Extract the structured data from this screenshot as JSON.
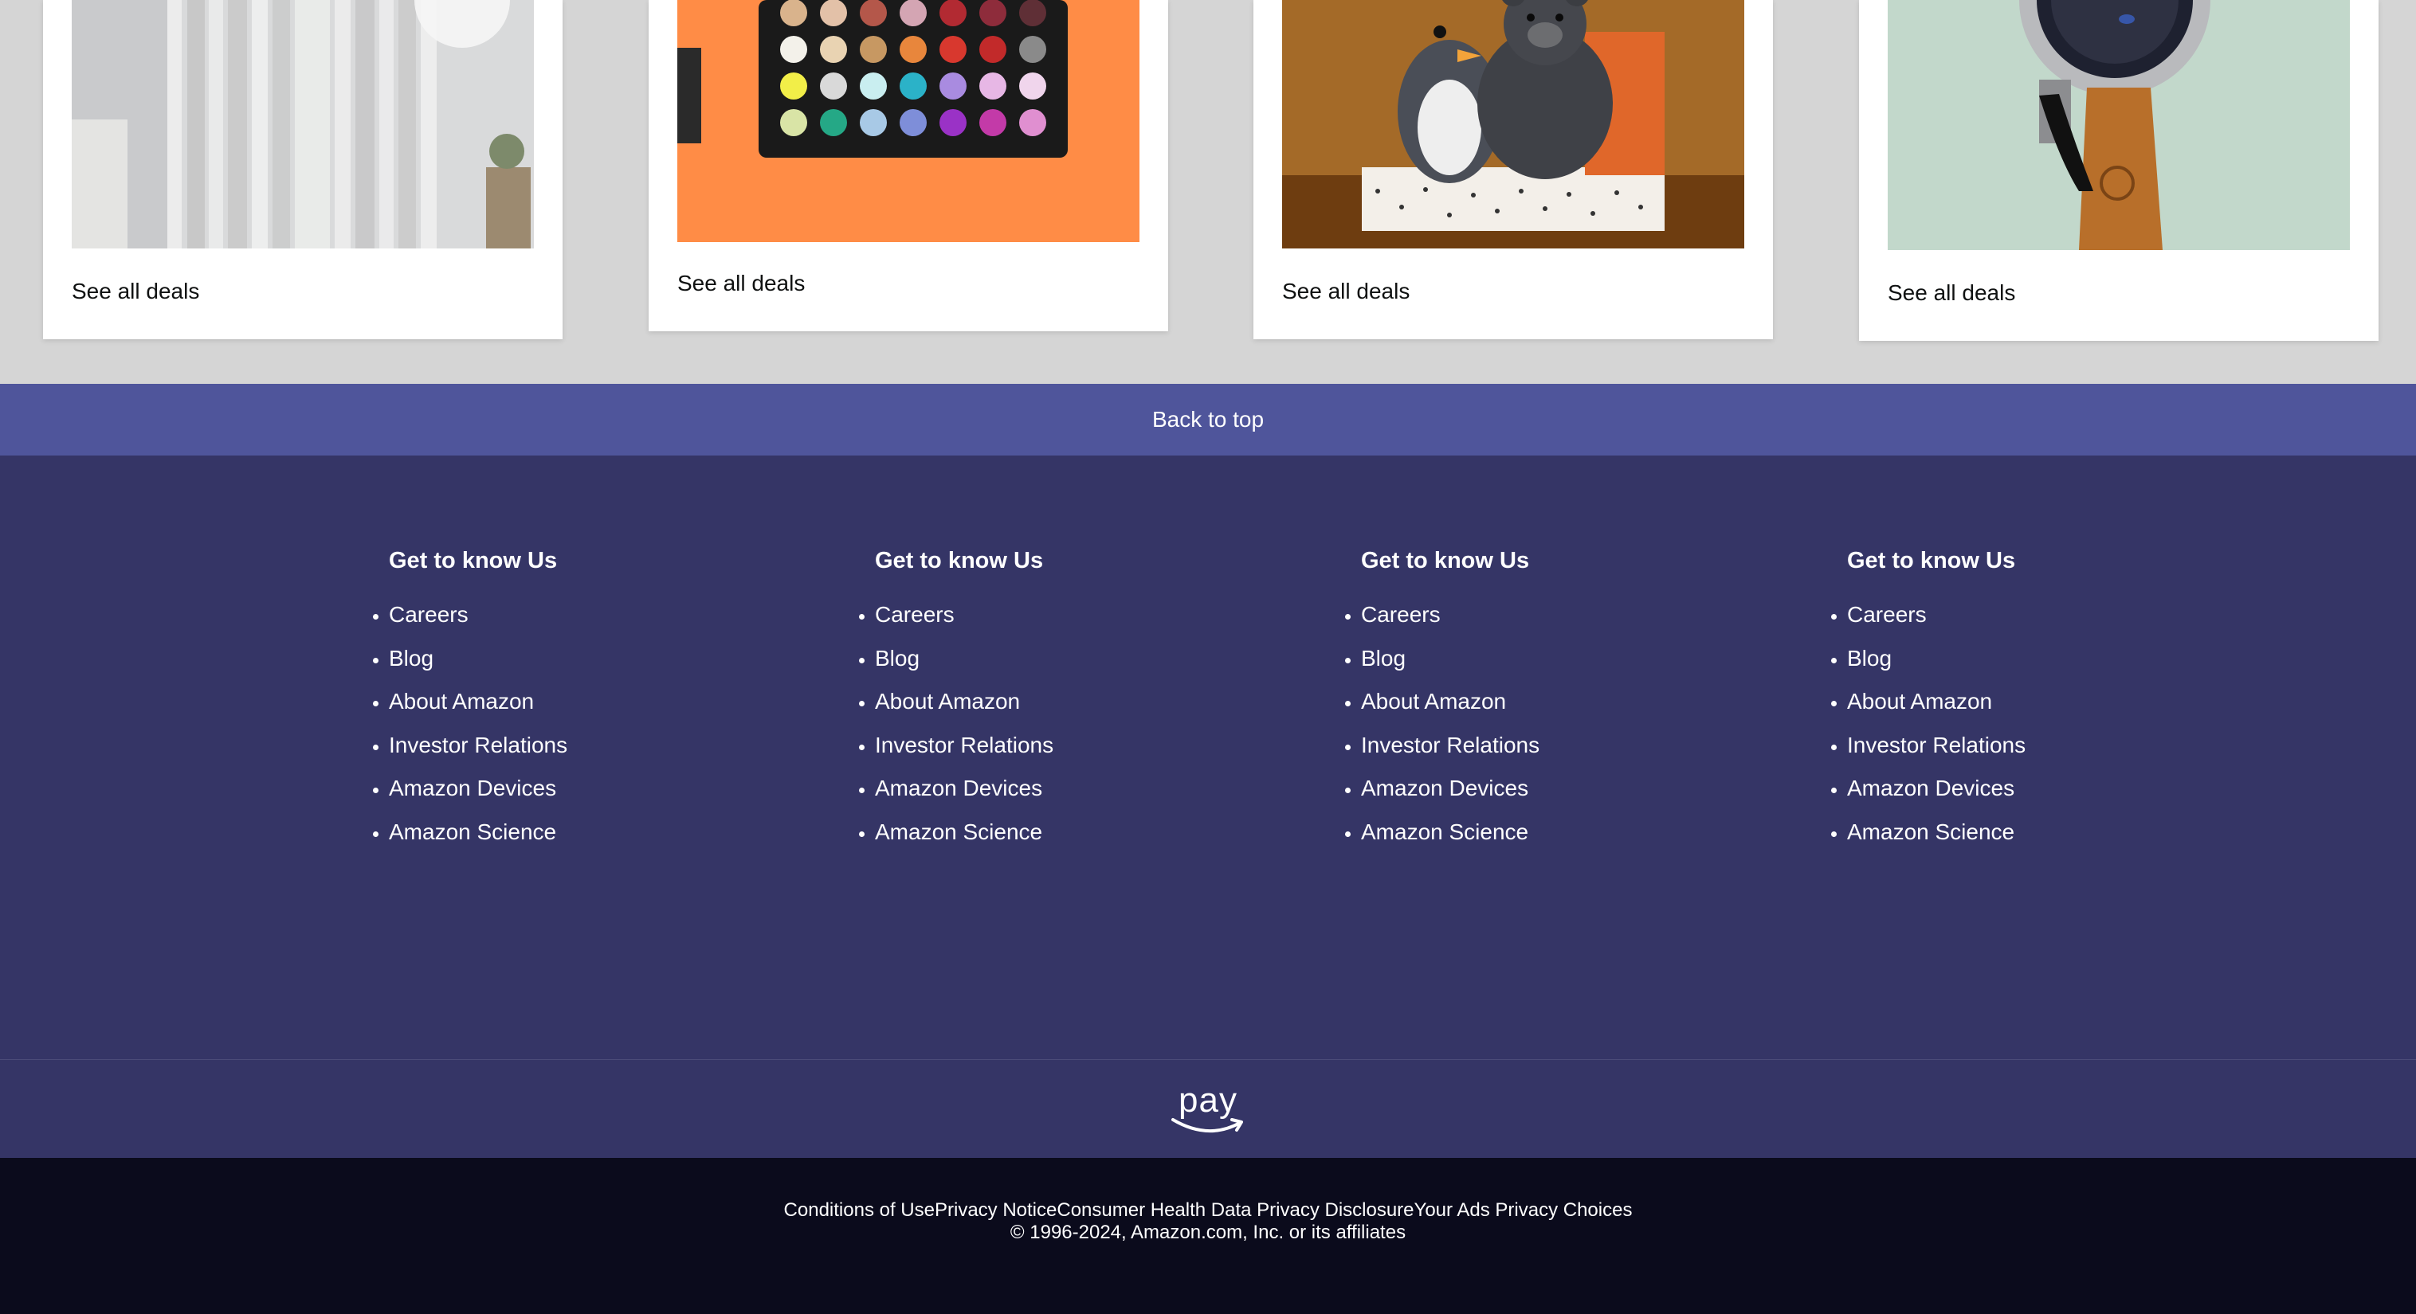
{
  "deals": {
    "cards": [
      {
        "see_all": "See all deals",
        "image": "curtains-photo"
      },
      {
        "see_all": "See all deals",
        "image": "eyeshadow-palette-photo"
      },
      {
        "see_all": "See all deals",
        "image": "plush-toys-photo"
      },
      {
        "see_all": "See all deals",
        "image": "wristwatch-photo"
      }
    ]
  },
  "back_to_top": "Back to top",
  "footer": {
    "columns": [
      {
        "heading": "Get to know Us",
        "links": [
          "Careers",
          "Blog",
          "About Amazon",
          "Investor Relations",
          "Amazon Devices",
          "Amazon Science"
        ]
      },
      {
        "heading": "Get to know Us",
        "links": [
          "Careers",
          "Blog",
          "About Amazon",
          "Investor Relations",
          "Amazon Devices",
          "Amazon Science"
        ]
      },
      {
        "heading": "Get to know Us",
        "links": [
          "Careers",
          "Blog",
          "About Amazon",
          "Investor Relations",
          "Amazon Devices",
          "Amazon Science"
        ]
      },
      {
        "heading": "Get to know Us",
        "links": [
          "Careers",
          "Blog",
          "About Amazon",
          "Investor Relations",
          "Amazon Devices",
          "Amazon Science"
        ]
      }
    ],
    "pay_logo_text": "pay",
    "bottom_links": [
      "Conditions of Use",
      "Privacy Notice",
      "Consumer Health Data Privacy Disclosure",
      "Your Ads Privacy Choices"
    ],
    "copyright": "© 1996-2024, Amazon.com, Inc. or its affiliates"
  },
  "colors": {
    "page_bg": "#d5d5d5",
    "back_to_top_bg": "#4f559b",
    "footer_bg": "#353566",
    "bottom_bar_bg": "#0b0b1c"
  }
}
